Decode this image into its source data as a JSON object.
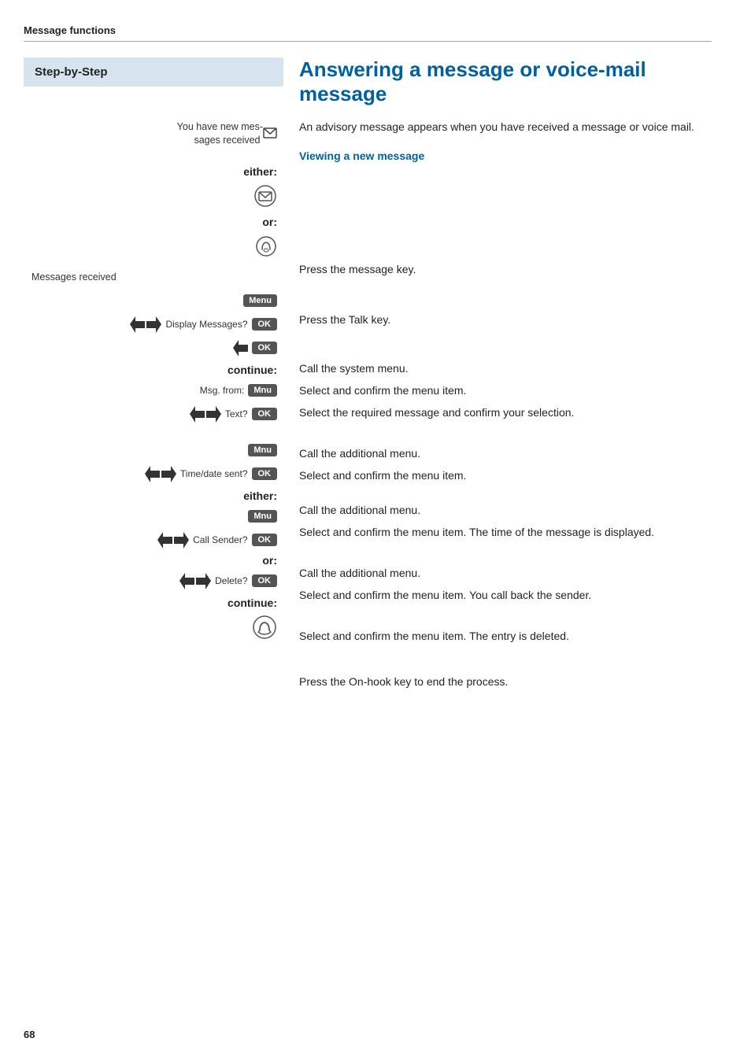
{
  "header": {
    "title": "Message functions"
  },
  "sidebar": {
    "title": "Step-by-Step"
  },
  "main": {
    "title": "Answering a message or voice-mail message",
    "intro": "An advisory message appears when you have received a message or voice mail.",
    "subheading": "Viewing a new message"
  },
  "steps": [
    {
      "id": "new-messages-label",
      "left_label": "You have new mes-sages received",
      "left_icon": "envelope-small",
      "right_text": ""
    },
    {
      "id": "either-1",
      "keyword": "either:",
      "right_text": ""
    },
    {
      "id": "message-key",
      "left_icon": "envelope-large",
      "right_text": "Press the message key."
    },
    {
      "id": "or-1",
      "keyword": "or:",
      "right_text": ""
    },
    {
      "id": "talk-key",
      "left_icon": "talk",
      "right_text": "Press the Talk key."
    },
    {
      "id": "messages-received",
      "left_label": "Messages received",
      "right_text": ""
    },
    {
      "id": "menu-1",
      "btn": "Menu",
      "btn_type": "menu",
      "right_text": "Call the system menu."
    },
    {
      "id": "display-messages",
      "arrows": true,
      "label": "Display Messages?",
      "btn": "OK",
      "btn_type": "ok",
      "right_text": "Select and confirm the menu item."
    },
    {
      "id": "select-message",
      "arrows_down_only": true,
      "btn": "OK",
      "btn_type": "ok",
      "right_text": "Select the required message and confirm your selection."
    },
    {
      "id": "continue-1",
      "keyword": "continue:",
      "right_text": ""
    },
    {
      "id": "msg-from",
      "label": "Msg. from:",
      "btn": "Mnu",
      "btn_type": "menu",
      "right_text": "Call the additional menu."
    },
    {
      "id": "text",
      "arrows": true,
      "label": "Text?",
      "btn": "OK",
      "btn_type": "ok",
      "right_text": "Select and confirm the menu item."
    },
    {
      "id": "spacer-1",
      "spacer": true
    },
    {
      "id": "mnu-2",
      "btn": "Mnu",
      "btn_type": "menu",
      "right_text": "Call the additional menu."
    },
    {
      "id": "time-date",
      "arrows": true,
      "label": "Time/date sent?",
      "btn": "OK",
      "btn_type": "ok",
      "right_text": "Select and confirm the menu item. The time of the message is displayed."
    },
    {
      "id": "either-2",
      "keyword": "either:",
      "right_text": ""
    },
    {
      "id": "mnu-3",
      "btn": "Mnu",
      "btn_type": "menu",
      "right_text": "Call the additional menu."
    },
    {
      "id": "call-sender",
      "arrows": true,
      "label": "Call Sender?",
      "btn": "OK",
      "btn_type": "ok",
      "right_text": "Select and confirm the menu item. You call back the sender."
    },
    {
      "id": "or-2",
      "keyword": "or:",
      "right_text": ""
    },
    {
      "id": "delete",
      "arrows": true,
      "label": "Delete?",
      "btn": "OK",
      "btn_type": "ok",
      "right_text": "Select and confirm the menu item. The entry is deleted."
    },
    {
      "id": "continue-2",
      "keyword": "continue:",
      "right_text": ""
    },
    {
      "id": "onhook",
      "left_icon": "onhook",
      "right_text": "Press the On-hook key to end the process."
    }
  ],
  "page_number": "68",
  "labels": {
    "either": "either:",
    "or": "or:",
    "continue": "continue:",
    "menu_btn": "Menu",
    "mnu_btn": "Mnu",
    "ok_btn": "OK"
  }
}
